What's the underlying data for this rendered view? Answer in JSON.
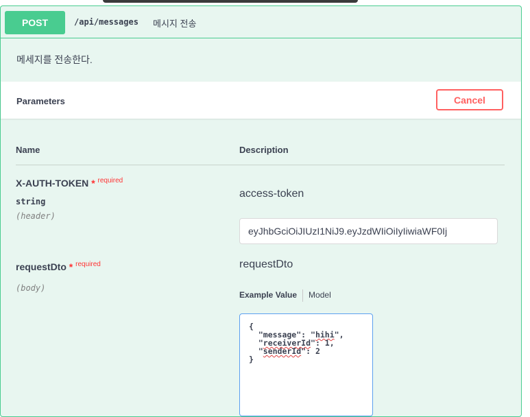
{
  "operation": {
    "method": "POST",
    "path": "/api/messages",
    "summary": "메시지 전송",
    "description": "메세지를 전송한다."
  },
  "parameters": {
    "title": "Parameters",
    "cancel_label": "Cancel",
    "columns": {
      "name": "Name",
      "description": "Description"
    },
    "items": [
      {
        "name": "X-AUTH-TOKEN",
        "required_mark": "*",
        "required_label": "required",
        "type": "string",
        "in": "(header)",
        "description": "access-token",
        "value": "eyJhbGciOiJIUzI1NiJ9.eyJzdWIiOiIyIiwiaWF0Ij"
      },
      {
        "name": "requestDto",
        "required_mark": "*",
        "required_label": "required",
        "in": "(body)",
        "description": "requestDto",
        "tabs": {
          "example": "Example Value",
          "model": "Model"
        },
        "example_lines": [
          "{",
          "  \"message\": \"hihi\",",
          "  \"receiverId\": 1,",
          "  \"senderId\": 2",
          "}"
        ]
      }
    ]
  },
  "colors": {
    "post": "#49cc90",
    "post_bg": "#e8f6f0",
    "cancel": "#ff6060",
    "required": "#ff3333"
  }
}
